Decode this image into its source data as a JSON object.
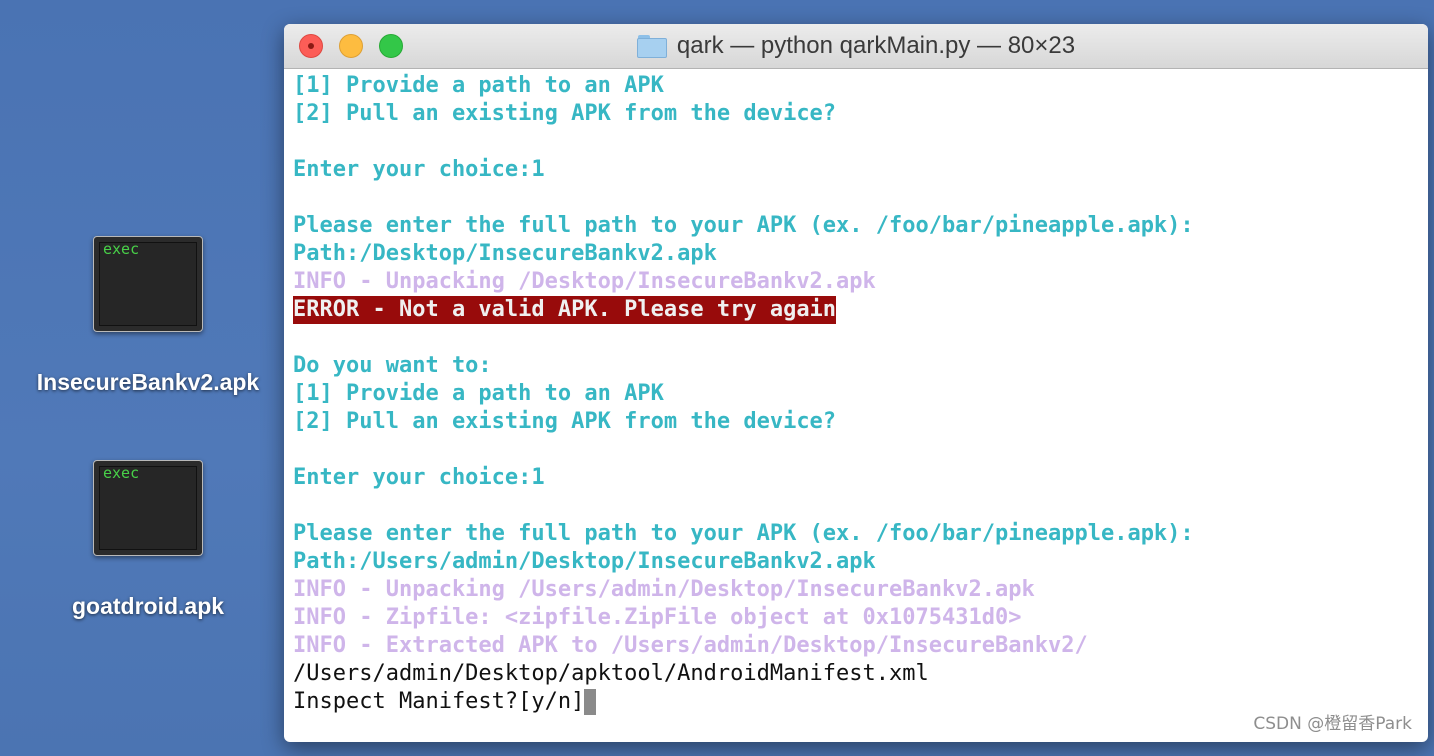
{
  "desktop": {
    "icons": [
      {
        "badge": "exec",
        "label": "InsecureBankv2.apk"
      },
      {
        "badge": "exec",
        "label": "goatdroid.apk"
      }
    ]
  },
  "window": {
    "title": "qark — python qarkMain.py — 80×23"
  },
  "terminal": {
    "lines": [
      {
        "style": "cyan",
        "text": "[1] Provide a path to an APK"
      },
      {
        "style": "cyan",
        "text": "[2] Pull an existing APK from the device?"
      },
      {
        "style": "blank",
        "text": ""
      },
      {
        "style": "cyan",
        "text": "Enter your choice:1"
      },
      {
        "style": "blank",
        "text": ""
      },
      {
        "style": "cyan",
        "text": "Please enter the full path to your APK (ex. /foo/bar/pineapple.apk):"
      },
      {
        "style": "cyan",
        "text": "Path:/Desktop/InsecureBankv2.apk"
      },
      {
        "style": "info",
        "text": "INFO - Unpacking /Desktop/InsecureBankv2.apk"
      },
      {
        "style": "error",
        "text": "ERROR - Not a valid APK. Please try again"
      },
      {
        "style": "blank",
        "text": ""
      },
      {
        "style": "cyan",
        "text": "Do you want to:"
      },
      {
        "style": "cyan",
        "text": "[1] Provide a path to an APK"
      },
      {
        "style": "cyan",
        "text": "[2] Pull an existing APK from the device?"
      },
      {
        "style": "blank",
        "text": ""
      },
      {
        "style": "cyan",
        "text": "Enter your choice:1"
      },
      {
        "style": "blank",
        "text": ""
      },
      {
        "style": "cyan",
        "text": "Please enter the full path to your APK (ex. /foo/bar/pineapple.apk):"
      },
      {
        "style": "cyan",
        "text": "Path:/Users/admin/Desktop/InsecureBankv2.apk"
      },
      {
        "style": "info",
        "text": "INFO - Unpacking /Users/admin/Desktop/InsecureBankv2.apk"
      },
      {
        "style": "info",
        "text": "INFO - Zipfile: <zipfile.ZipFile object at 0x1075431d0>"
      },
      {
        "style": "info",
        "text": "INFO - Extracted APK to /Users/admin/Desktop/InsecureBankv2/"
      },
      {
        "style": "plain",
        "text": "/Users/admin/Desktop/apktool/AndroidManifest.xml"
      },
      {
        "style": "plain",
        "text": "Inspect Manifest?[y/n]",
        "cursor": true
      }
    ]
  },
  "watermark": "CSDN @橙留香Park",
  "colors": {
    "desktop": "#4d75b4",
    "prompt_cyan": "#37b7c4",
    "info_lavender": "#cfb5ea",
    "error_bg": "#980b0b"
  }
}
